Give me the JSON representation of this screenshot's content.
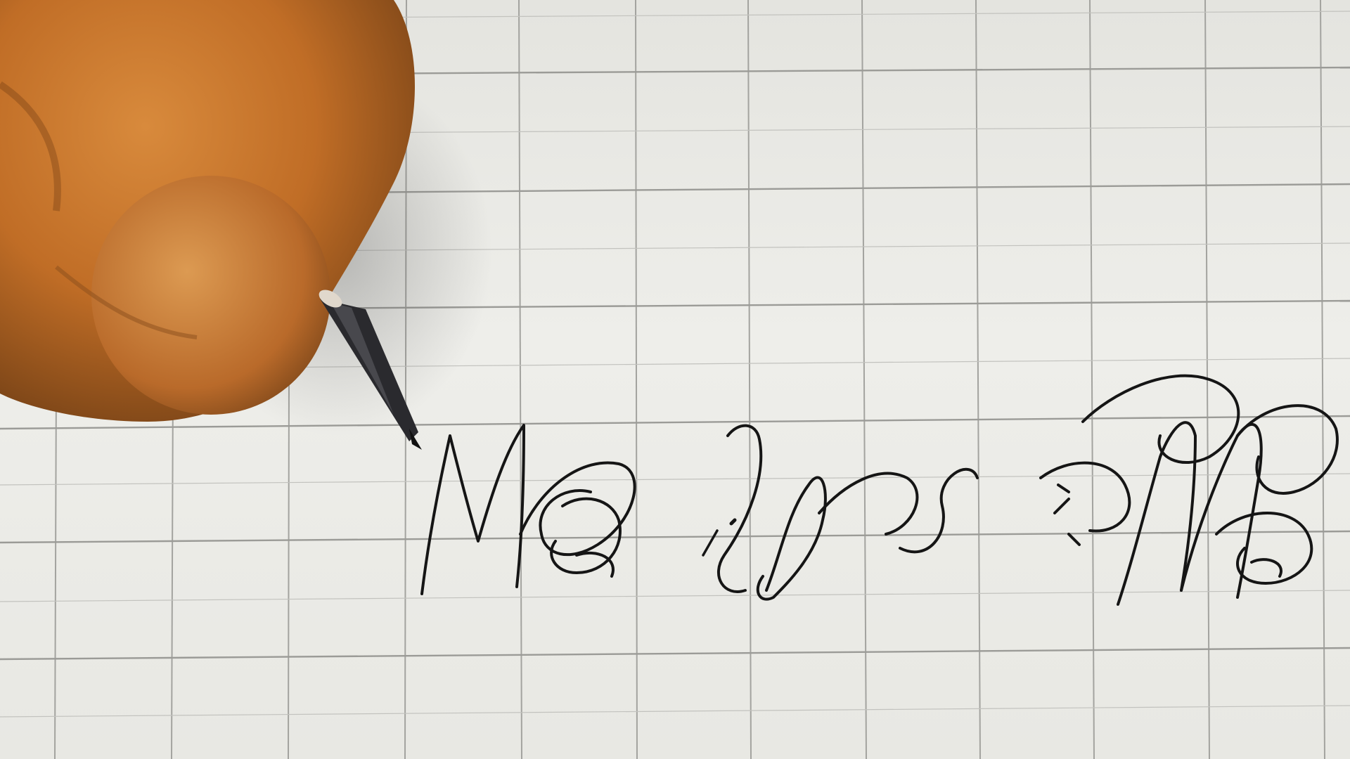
{
  "scene": {
    "description_colors": {
      "paper": "#eeeeea",
      "grid_line": "#9a9a96",
      "ink": "#151515",
      "hand": "#c9772e",
      "hand_shadow": "#8a4e1c",
      "pen_tip": "#2a2a2e"
    },
    "handwritten_text": "MO ha. OM"
  }
}
